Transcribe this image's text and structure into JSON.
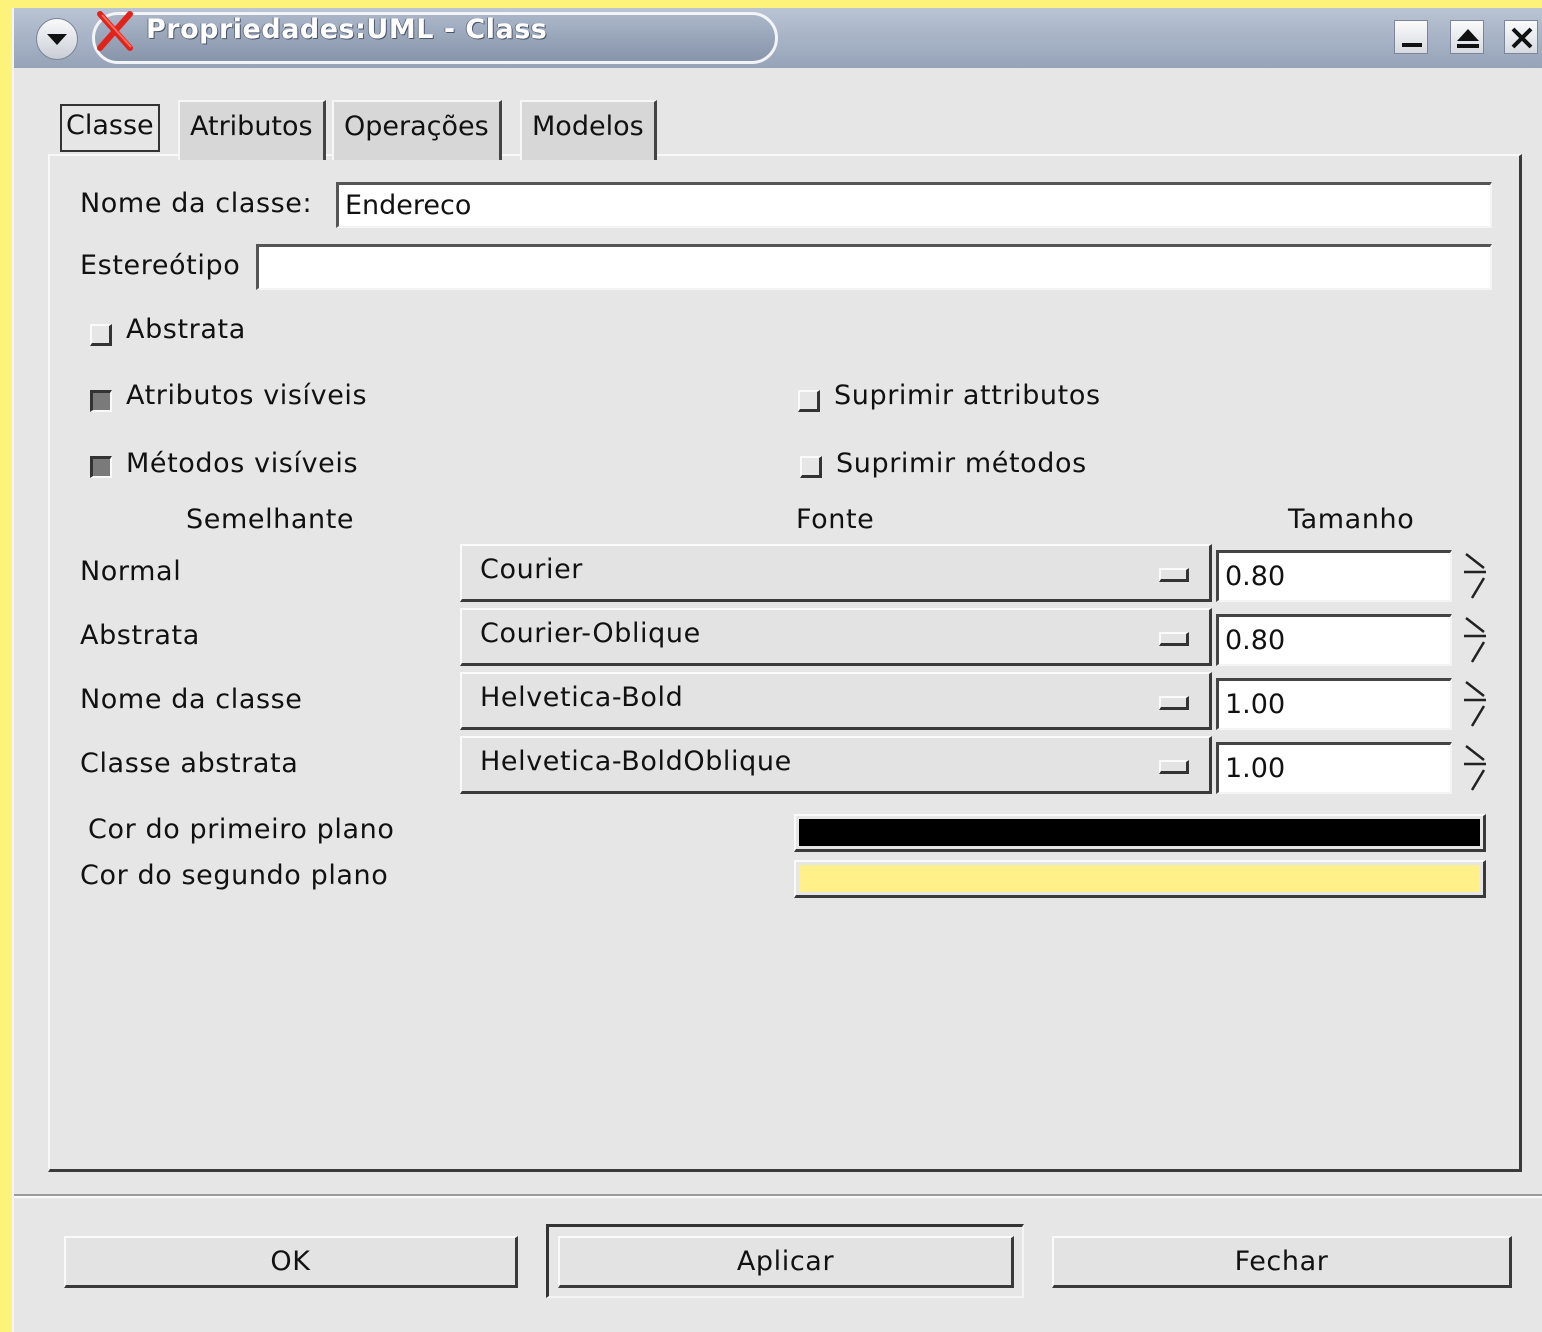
{
  "window": {
    "title": "Propriedades:UML - Class"
  },
  "tabs": [
    {
      "label": "Classe",
      "active": true
    },
    {
      "label": "Atributos",
      "active": false
    },
    {
      "label": "Operações",
      "active": false
    },
    {
      "label": "Modelos",
      "active": false
    }
  ],
  "form": {
    "class_name_label": "Nome da classe:",
    "class_name_value": "Endereco",
    "stereotype_label": "Estereótipo",
    "stereotype_value": "",
    "abstract_label": "Abstrata",
    "abstract_checked": false,
    "attrs_visible_label": "Atributos visíveis",
    "attrs_visible_checked": true,
    "methods_visible_label": "Métodos visíveis",
    "methods_visible_checked": true,
    "suppress_attrs_label": "Suprimir attributos",
    "suppress_attrs_checked": false,
    "suppress_methods_label": "Suprimir métodos",
    "suppress_methods_checked": false
  },
  "fonts": {
    "header_look": "Semelhante",
    "header_font": "Fonte",
    "header_size": "Tamanho",
    "rows": [
      {
        "label": "Normal",
        "font": "Courier",
        "size": "0.80"
      },
      {
        "label": "Abstrata",
        "font": "Courier-Oblique",
        "size": "0.80"
      },
      {
        "label": "Nome da classe",
        "font": "Helvetica-Bold",
        "size": "1.00"
      },
      {
        "label": "Classe abstrata",
        "font": "Helvetica-BoldOblique",
        "size": "1.00"
      }
    ]
  },
  "colors": {
    "foreground_label": "Cor do primeiro plano",
    "foreground": "#000000",
    "background_label": "Cor do segundo plano",
    "background": "#fff08a"
  },
  "buttons": {
    "ok": "OK",
    "apply": "Aplicar",
    "close": "Fechar"
  }
}
